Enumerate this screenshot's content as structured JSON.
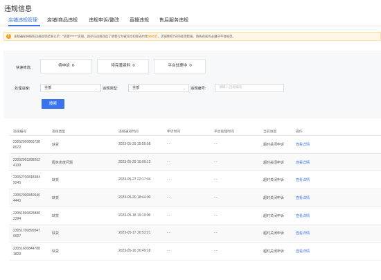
{
  "page_title": "违规信息",
  "tabs": [
    {
      "label": "店铺违规管理"
    },
    {
      "label": "店铺/商品违规"
    },
    {
      "label": "违规申诉/整改"
    },
    {
      "label": "直播违规"
    },
    {
      "label": "售后服务违规"
    }
  ],
  "notice": {
    "icon": "warning-icon",
    "text_before": "违规通知将按照违规处罚结果公示：\"诺善******\"店铺，因存在违规违反了销售行为被冻结扣除违约金",
    "highlight": "3000元",
    "text_after": "，店铺降权7日的处理措施。请各商家务必遵守平台规范。",
    "accent_color": "#ff7a00"
  },
  "filters": {
    "quick_label": "快速筛选:",
    "quick_buttons": [
      {
        "label": "待申诉",
        "count": "0"
      },
      {
        "label": "待完善资料",
        "count": "0"
      },
      {
        "label": "平台处理中",
        "count": "0"
      }
    ],
    "status_label": "处理进度:",
    "status_value": "全部",
    "type_label": "违规类型:",
    "type_value": "全部",
    "number_label": "违规编号:",
    "number_placeholder": "请输入违规编号",
    "search_button": "搜索"
  },
  "table": {
    "columns": [
      "违规编号",
      "违规类型",
      "违规通知时间",
      "申诉时间",
      "平台处理时间",
      "当前进度",
      "操作"
    ],
    "rows": [
      {
        "id_line1": "23052900866738",
        "id_line2": "8072",
        "type": "缺货",
        "notify_time": "2023-05-29 19:50:58",
        "appeal_time": "- -",
        "platform_time": "- -",
        "progress": "超时关闭申诉",
        "action": "查看详情"
      },
      {
        "id_line1": "23052903288262",
        "id_line2": "4139",
        "type": "服务态度问题",
        "notify_time": "2023-05-29 10:00:12",
        "appeal_time": "- -",
        "platform_time": "- -",
        "progress": "超时关闭申诉",
        "action": "查看详情"
      },
      {
        "id_line1": "23052700818384",
        "id_line2": "9245",
        "type": "缺货",
        "notify_time": "2023-05-27 22:17:34",
        "appeal_time": "- -",
        "platform_time": "- -",
        "progress": "超时关闭申诉",
        "action": "查看详情"
      },
      {
        "id_line1": "23052000840646",
        "id_line2": "4443",
        "type": "缺货",
        "notify_time": "2023-05-20 18:44:00",
        "appeal_time": "- -",
        "platform_time": "- -",
        "progress": "超时关闭申诉",
        "action": "查看详情"
      },
      {
        "id_line1": "23051800826880",
        "id_line2": "2394",
        "type": "缺货",
        "notify_time": "2023-05-18 19:19:09",
        "appeal_time": "- -",
        "platform_time": "- -",
        "progress": "超时关闭申诉",
        "action": "查看详情"
      },
      {
        "id_line1": "23051700899947",
        "id_line2": "0007",
        "type": "缺货",
        "notify_time": "2023-05-17 20:53:21",
        "appeal_time": "- -",
        "platform_time": "- -",
        "progress": "超时关闭申诉",
        "action": "查看详情"
      },
      {
        "id_line1": "23051600844788",
        "id_line2": "1823",
        "type": "缺货",
        "notify_time": "2023-05-16 20:49:18",
        "appeal_time": "- -",
        "platform_time": "- -",
        "progress": "超时关闭申诉",
        "action": "查看详情"
      }
    ]
  }
}
